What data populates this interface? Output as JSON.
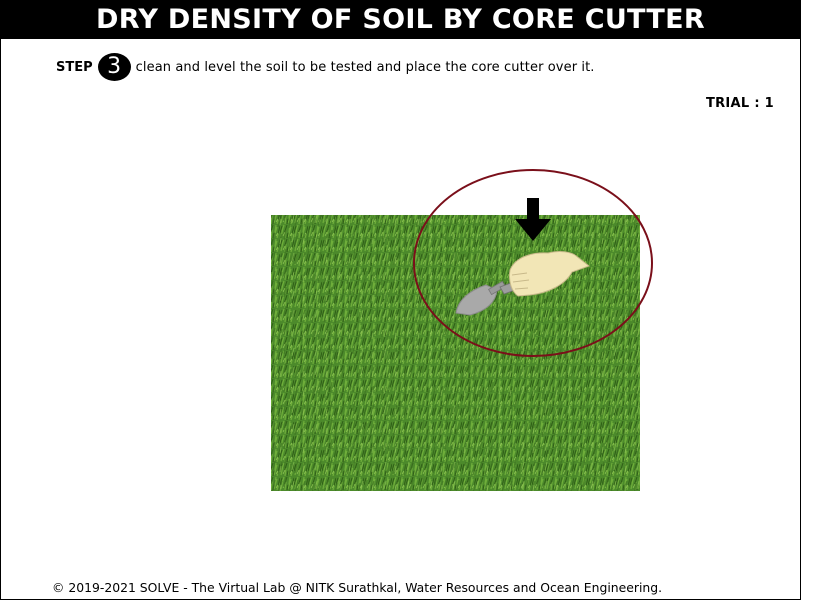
{
  "header": {
    "title": "DRY DENSITY OF SOIL BY CORE CUTTER"
  },
  "step": {
    "label": "STEP",
    "number": "3",
    "instruction": "clean and level the soil to be tested and place the core cutter over it."
  },
  "trial": {
    "text": "TRIAL : 1"
  },
  "scene": {
    "icons": [
      "grass-image",
      "trowel-icon",
      "hand-icon",
      "down-arrow-icon",
      "highlight-circle"
    ],
    "colors": {
      "grass": "#4e8a2a",
      "circle": "#7a0f1a",
      "trowel": "#a9a9a9",
      "hand": "#f2e6b6"
    }
  },
  "footer": {
    "text": "© 2019-2021 SOLVE - The Virtual Lab @ NITK Surathkal, Water Resources and Ocean Engineering."
  }
}
